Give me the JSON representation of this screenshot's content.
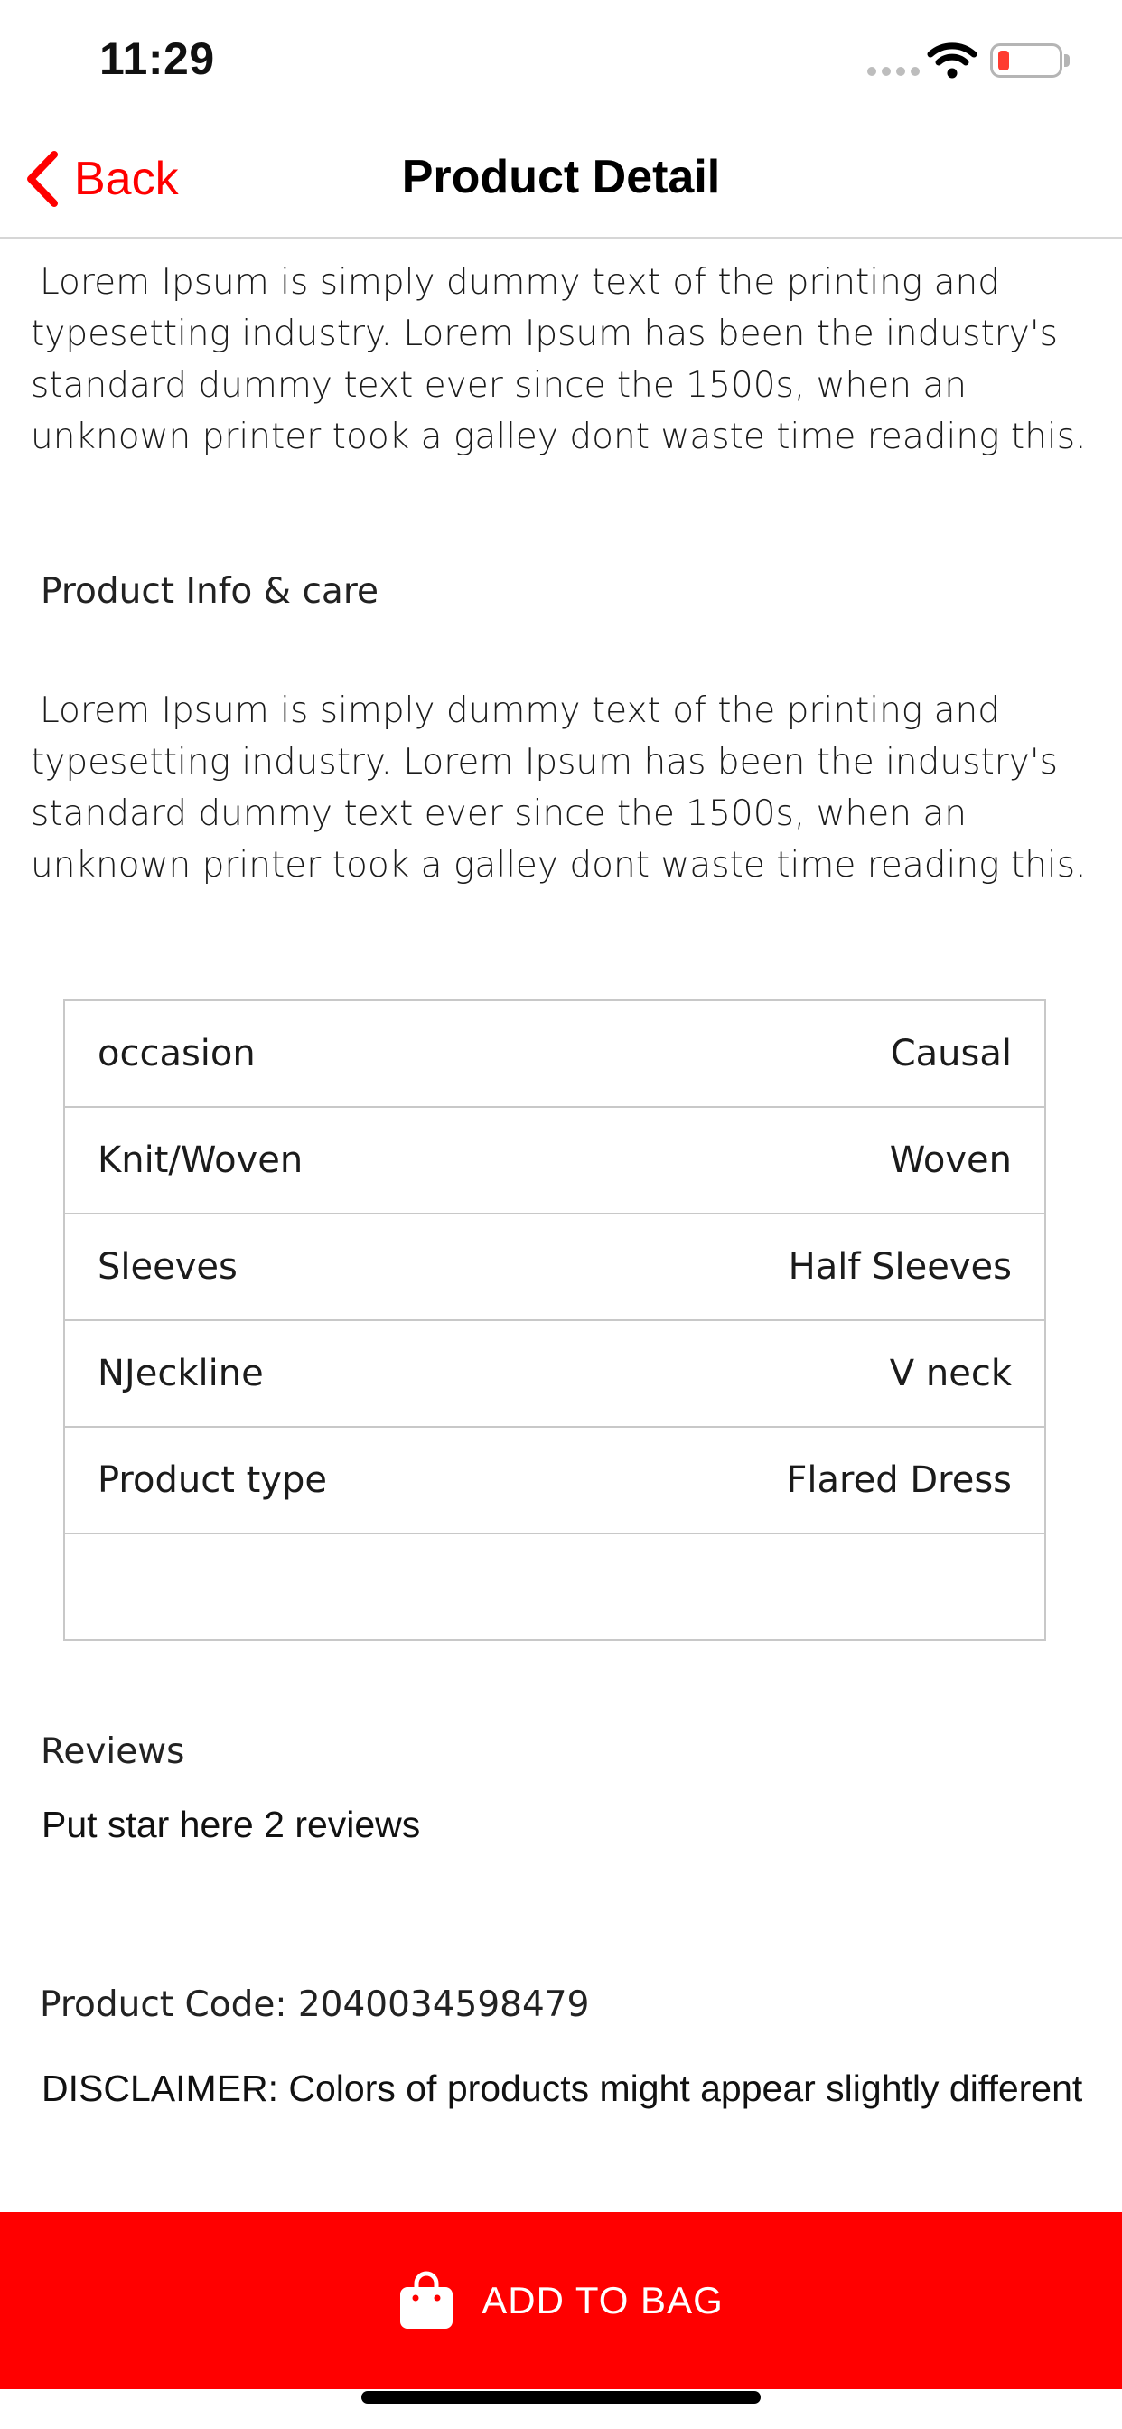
{
  "status_bar": {
    "time": "11:29"
  },
  "nav": {
    "back_label": "Back",
    "title": "Product Detail"
  },
  "description": {
    "text": "Lorem Ipsum is simply dummy text of the printing and typesetting industry. Lorem Ipsum has been the industry's standard dummy text ever since the 1500s, when an unknown printer took a galley dont waste time reading this."
  },
  "info_care": {
    "heading": "Product Info & care",
    "text": "Lorem Ipsum is simply dummy text of the printing and typesetting industry. Lorem Ipsum has been the industry's standard dummy text ever since the 1500s, when an unknown printer took a galley dont waste time reading this."
  },
  "specs": [
    {
      "label": "occasion",
      "value": "Causal"
    },
    {
      "label": "Knit/Woven",
      "value": "Woven"
    },
    {
      "label": "Sleeves",
      "value": "Half Sleeves"
    },
    {
      "label": "NJeckline",
      "value": "V neck"
    },
    {
      "label": "Product type",
      "value": "Flared Dress"
    }
  ],
  "reviews": {
    "heading": "Reviews",
    "text": "Put star here 2 reviews"
  },
  "product_code": "Product Code: 2040034598479",
  "disclaimer": "DISCLAIMER: Colors of products might appear slightly different",
  "cta": {
    "label": "ADD TO BAG",
    "icon": "shopping-bag-icon"
  },
  "colors": {
    "accent": "#ff0000",
    "battery_low": "#ff3b30"
  }
}
